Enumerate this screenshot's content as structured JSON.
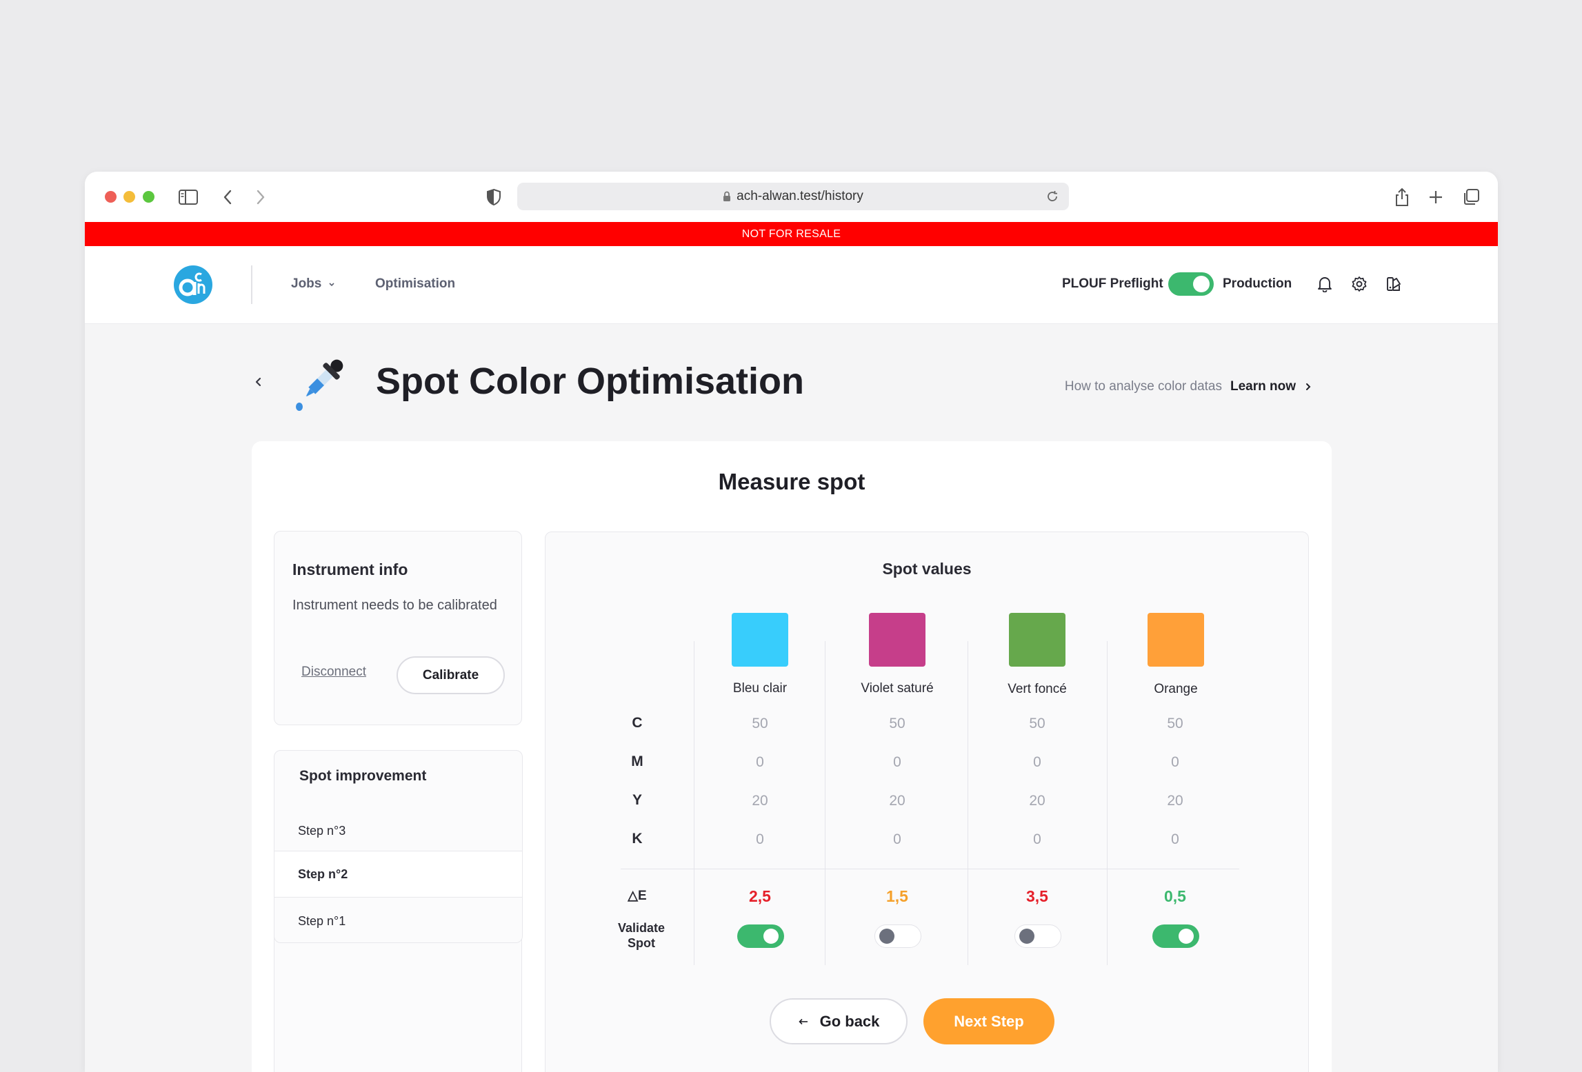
{
  "browser": {
    "url": "ach-alwan.test/history"
  },
  "banner": {
    "text": "NOT FOR RESALE"
  },
  "nav": {
    "logo_icon": "ach-logo-icon",
    "jobs_label": "Jobs",
    "optimisation_label": "Optimisation",
    "env_left": "PLOUF Preflight",
    "env_right": "Production",
    "env_toggle_on": true
  },
  "page": {
    "title": "Spot Color Optimisation",
    "help_text": "How to analyse color datas",
    "learn_label": "Learn now"
  },
  "main": {
    "title": "Measure spot",
    "instrument": {
      "title": "Instrument info",
      "text": "Instrument needs to be calibrated",
      "disconnect_label": "Disconnect",
      "calibrate_label": "Calibrate"
    },
    "improvement": {
      "title": "Spot improvement",
      "steps": [
        {
          "label": "Step n°3",
          "active": false
        },
        {
          "label": "Step n°2",
          "active": true
        },
        {
          "label": "Step n°1",
          "active": false
        }
      ]
    },
    "spots": {
      "title": "Spot values",
      "row_labels": [
        "C",
        "M",
        "Y",
        "K"
      ],
      "delta_label": "△E",
      "validate_label": "Validate Spot",
      "items": [
        {
          "name": "Bleu clair",
          "color": "#38cdfc",
          "c": "50",
          "m": "0",
          "y": "20",
          "k": "0",
          "delta_e": "2,5",
          "delta_color": "#e5202a",
          "validated": true
        },
        {
          "name": "Violet saturé",
          "color": "#c63e8a",
          "c": "50",
          "m": "0",
          "y": "20",
          "k": "0",
          "delta_e": "1,5",
          "delta_color": "#f5a02a",
          "validated": false
        },
        {
          "name": "Vert foncé",
          "color": "#66a84c",
          "c": "50",
          "m": "0",
          "y": "20",
          "k": "0",
          "delta_e": "3,5",
          "delta_color": "#e5202a",
          "validated": false
        },
        {
          "name": "Orange",
          "color": "#ffa039",
          "c": "50",
          "m": "0",
          "y": "20",
          "k": "0",
          "delta_e": "0,5",
          "delta_color": "#3cb86e",
          "validated": true
        }
      ]
    },
    "actions": {
      "back_label": "Go back",
      "next_label": "Next Step"
    }
  },
  "colors": {
    "accent_orange": "#ffa12e",
    "toggle_green": "#3cb86e",
    "banner_red": "#ff0000",
    "logo_blue": "#2aa7e0"
  }
}
